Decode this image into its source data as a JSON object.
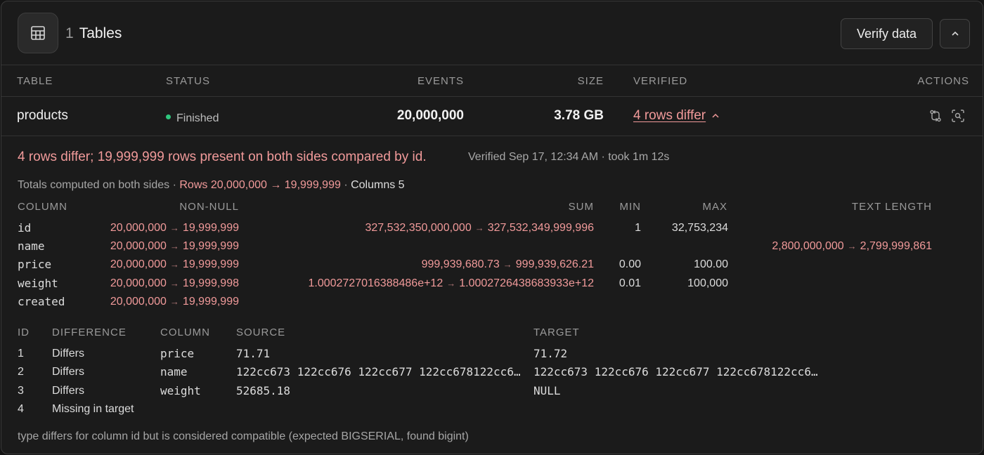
{
  "header": {
    "count": "1",
    "title": "Tables",
    "verify_label": "Verify data"
  },
  "table_columns": {
    "table": "TABLE",
    "status": "STATUS",
    "events": "EVENTS",
    "size": "SIZE",
    "verified": "VERIFIED",
    "actions": "ACTIONS"
  },
  "row": {
    "name": "products",
    "status": "Finished",
    "events": "20,000,000",
    "size": "3.78 GB",
    "verified": "4 rows differ"
  },
  "detail": {
    "summary": "4 rows differ; 19,999,999 rows present on both sides compared by id.",
    "verified_info": "Verified Sep 17, 12:34 AM · took 1m 12s",
    "totals_prefix": "Totals computed on both sides ·",
    "totals_rows": "Rows 20,000,000 → 19,999,999",
    "totals_sep": "·",
    "totals_columns": "Columns 5"
  },
  "stats": {
    "headers": {
      "column": "COLUMN",
      "nonnull": "NON-NULL",
      "sum": "SUM",
      "min": "MIN",
      "max": "MAX",
      "textlen": "TEXT LENGTH"
    },
    "arrow": "→",
    "rows": [
      {
        "column": "id",
        "nonnull_src": "20,000,000",
        "nonnull_dst": "19,999,999",
        "sum_src": "327,532,350,000,000",
        "sum_dst": "327,532,349,999,996",
        "min": "1",
        "max": "32,753,234",
        "text_src": "",
        "text_dst": ""
      },
      {
        "column": "name",
        "nonnull_src": "20,000,000",
        "nonnull_dst": "19,999,999",
        "sum_src": "",
        "sum_dst": "",
        "min": "",
        "max": "",
        "text_src": "2,800,000,000",
        "text_dst": "2,799,999,861"
      },
      {
        "column": "price",
        "nonnull_src": "20,000,000",
        "nonnull_dst": "19,999,999",
        "sum_src": "999,939,680.73",
        "sum_dst": "999,939,626.21",
        "min": "0.00",
        "max": "100.00",
        "text_src": "",
        "text_dst": ""
      },
      {
        "column": "weight",
        "nonnull_src": "20,000,000",
        "nonnull_dst": "19,999,998",
        "sum_src": "1.0002727016388486e+12",
        "sum_dst": "1.0002726438683933e+12",
        "min": "0.01",
        "max": "100,000",
        "text_src": "",
        "text_dst": ""
      },
      {
        "column": "created",
        "nonnull_src": "20,000,000",
        "nonnull_dst": "19,999,999",
        "sum_src": "",
        "sum_dst": "",
        "min": "",
        "max": "",
        "text_src": "",
        "text_dst": ""
      }
    ]
  },
  "diffs": {
    "headers": {
      "id": "ID",
      "difference": "DIFFERENCE",
      "column": "COLUMN",
      "source": "SOURCE",
      "target": "TARGET"
    },
    "rows": [
      {
        "id": "1",
        "difference": "Differs",
        "column": "price",
        "source": "71.71",
        "target": "71.72"
      },
      {
        "id": "2",
        "difference": "Differs",
        "column": "name",
        "source": "122cc673 122cc676 122cc677 122cc678122cc6…",
        "target": "122cc673 122cc676 122cc677 122cc678122cc6…"
      },
      {
        "id": "3",
        "difference": "Differs",
        "column": "weight",
        "source": "52685.18",
        "target": "NULL"
      },
      {
        "id": "4",
        "difference": "Missing in target",
        "column": "",
        "source": "",
        "target": ""
      }
    ]
  },
  "footnote": "type differs for column id but is considered compatible (expected BIGSERIAL, found bigint)",
  "icons": {
    "table": "table-grid-icon",
    "collapse": "chevron-up-icon",
    "compare": "compare-arrows-icon",
    "inspect": "scan-search-icon",
    "verified_toggle": "chevron-up-icon"
  },
  "colors": {
    "accent_diff": "#f19a9a",
    "status_ok": "#2fc77e",
    "background": "#1b1b1b"
  }
}
